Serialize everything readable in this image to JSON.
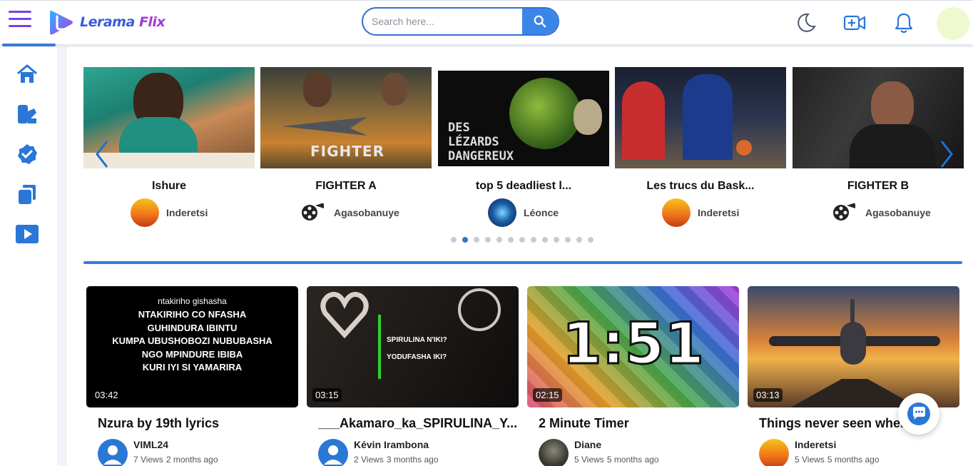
{
  "app": {
    "logo_part1": "Lerama",
    "logo_part2": "Flix"
  },
  "search": {
    "placeholder": "Search here..."
  },
  "header_icons": [
    "moon-icon",
    "video-add-icon",
    "bell-icon",
    "user-avatar"
  ],
  "sidebar": {
    "items": [
      "home-icon",
      "shorts-icon",
      "verified-icon",
      "library-icon",
      "play-icon"
    ]
  },
  "carousel": {
    "items": [
      {
        "title": "Ishure",
        "channel": "Inderetsi"
      },
      {
        "title": "FIGHTER A",
        "channel": "Agasobanuye"
      },
      {
        "title": "top 5 deadliest l...",
        "channel": "Léonce",
        "thumb_text": "DES LÉZARDS DANGEREUX"
      },
      {
        "title": "Les trucs du Bask...",
        "channel": "Inderetsi"
      },
      {
        "title": "FIGHTER B",
        "channel": "Agasobanuye"
      }
    ],
    "dot_count": 13,
    "active_dot": 1
  },
  "videos": [
    {
      "title": "Nzura by 19th lyrics",
      "duration": "03:42",
      "author": "VIML24",
      "views": "7 Views",
      "age": "2 months ago",
      "lyrics_small": "ntakiriho gishasha",
      "lyrics": [
        "NTAKIRIHO CO NFASHA",
        "GUHINDURA IBINTU",
        "KUMPA UBUSHOBOZI NUBUBASHA",
        "NGO MPINDURE IBIBA",
        "KURI IYI SI YAMARIRA"
      ]
    },
    {
      "title": "___Akamaro_ka_SPIRULINA_Y...",
      "duration": "03:15",
      "author": "Kévin Irambona",
      "views": "2 Views",
      "age": "3 months ago",
      "overlay": [
        "SPIRULINA N'IKI?",
        "YODUFASHA IKI?"
      ]
    },
    {
      "title": "2 Minute Timer",
      "duration": "02:15",
      "author": "Diane",
      "views": "5 Views",
      "age": "5 months ago",
      "timer": "1:51"
    },
    {
      "title": "Things never seen when...",
      "duration": "03:13",
      "author": "Inderetsi",
      "views": "5 Views",
      "age": "5 months ago"
    }
  ],
  "colors": {
    "accent": "#3a86e6",
    "brand_purple": "#7b3fe4",
    "divider": "#3a7bd5"
  }
}
